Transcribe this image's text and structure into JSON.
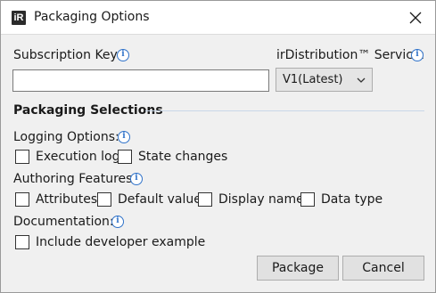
{
  "window": {
    "app_icon_text": "iR",
    "title": "Packaging Options",
    "close_icon": "close-icon"
  },
  "subscription": {
    "label": "Subscription Key:",
    "value": "",
    "placeholder": ""
  },
  "service": {
    "label": "irDistribution™ Service:",
    "selected": "V1(Latest)"
  },
  "packaging": {
    "section_title": "Packaging Selections",
    "logging": {
      "label": "Logging Options:",
      "options": [
        {
          "label": "Execution log",
          "checked": false
        },
        {
          "label": "State changes",
          "checked": false
        }
      ]
    },
    "authoring": {
      "label": "Authoring Features:",
      "options": [
        {
          "label": "Attributes",
          "checked": false
        },
        {
          "label": "Default value",
          "checked": false
        },
        {
          "label": "Display name",
          "checked": false
        },
        {
          "label": "Data type",
          "checked": false
        }
      ]
    },
    "documentation": {
      "label": "Documentation:",
      "options": [
        {
          "label": "Include developer example",
          "checked": false
        }
      ]
    }
  },
  "buttons": {
    "package": "Package",
    "cancel": "Cancel"
  },
  "colors": {
    "info_icon": "#2f72c9",
    "dialog_bg": "#f0f0f0",
    "button_bg": "#e1e1e1"
  }
}
